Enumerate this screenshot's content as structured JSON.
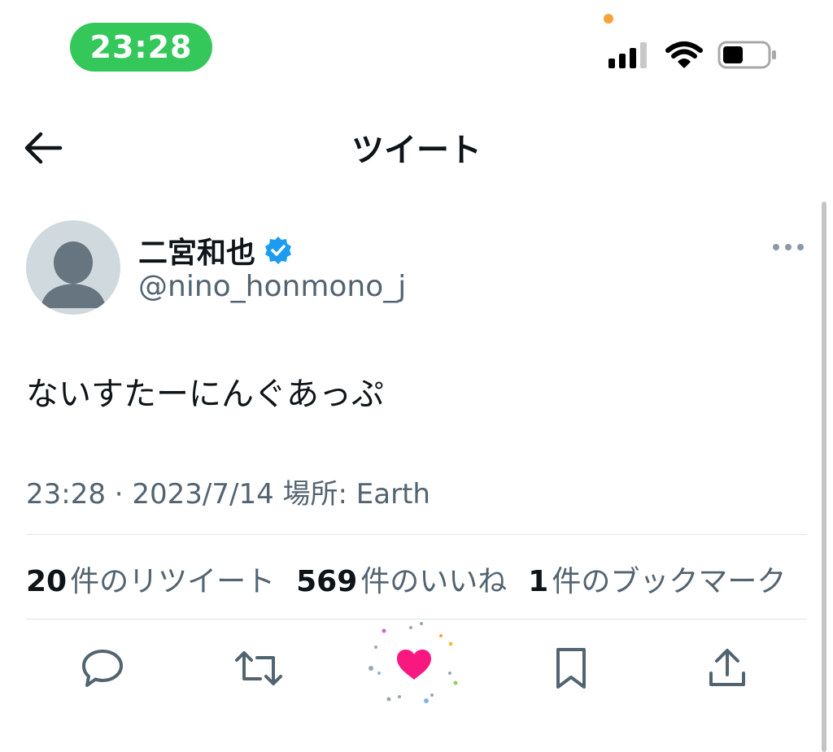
{
  "status_bar": {
    "time": "23:28",
    "icons": [
      "cellular-signal-icon",
      "wifi-icon",
      "battery-icon"
    ],
    "accent_colors": {
      "time_pill": "#34c759",
      "privacy_dot": "#f6a33c"
    }
  },
  "header": {
    "title": "ツイート",
    "back_icon": "arrow-left-icon"
  },
  "tweet": {
    "author": {
      "name": "二宮和也",
      "verified_icon": "verified-badge-icon",
      "handle": "@nino_honmono_j"
    },
    "text": "ないすたーにんぐあっぷ",
    "meta": "23:28 · 2023/7/14 場所: Earth",
    "stats": {
      "retweets": {
        "count": "20",
        "label": "件のリツイート"
      },
      "likes": {
        "count": "569",
        "label": "件のいいね"
      },
      "bookmarks": {
        "count": "1",
        "label": "件のブックマーク"
      }
    },
    "actions": [
      "reply-icon",
      "retweet-icon",
      "like-icon",
      "bookmark-icon",
      "share-icon"
    ],
    "colors": {
      "verified": "#1d9bf0",
      "like_active": "#f91880",
      "secondary_text": "#536471"
    }
  }
}
